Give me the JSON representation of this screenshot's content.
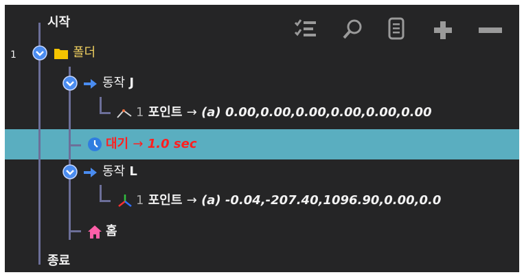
{
  "toolbar": {
    "icons": [
      "checklist-icon",
      "search-icon",
      "document-icon",
      "plus-icon",
      "minus-icon"
    ]
  },
  "tree": {
    "start_label": "시작",
    "end_label": "종료",
    "folder": {
      "index": "1",
      "label": "폴더"
    },
    "motion_j": {
      "label": "동작",
      "suffix": "J"
    },
    "point_j": {
      "index": "1",
      "label": "포인트",
      "arrow": "→",
      "value": "(a) 0.00,0.00,0.00,0.00,0.00,0.00"
    },
    "wait": {
      "label": "대기",
      "arrow": "→",
      "value": "1.0 sec"
    },
    "motion_l": {
      "label": "동작",
      "suffix": "L"
    },
    "point_l": {
      "index": "1",
      "label": "포인트",
      "arrow": "→",
      "value": "(a) -0.04,-207.40,1096.90,0.00,0.0"
    },
    "home": {
      "label": "홈"
    }
  },
  "colors": {
    "background": "#252526",
    "selected_row": "#5aaec0",
    "tree_line": "#6c6f99",
    "wait_text": "#ff2020",
    "folder_text": "#f0d060",
    "motion_arrow": "#4a8cf0",
    "chevron_circle": "#4a8cf0"
  }
}
